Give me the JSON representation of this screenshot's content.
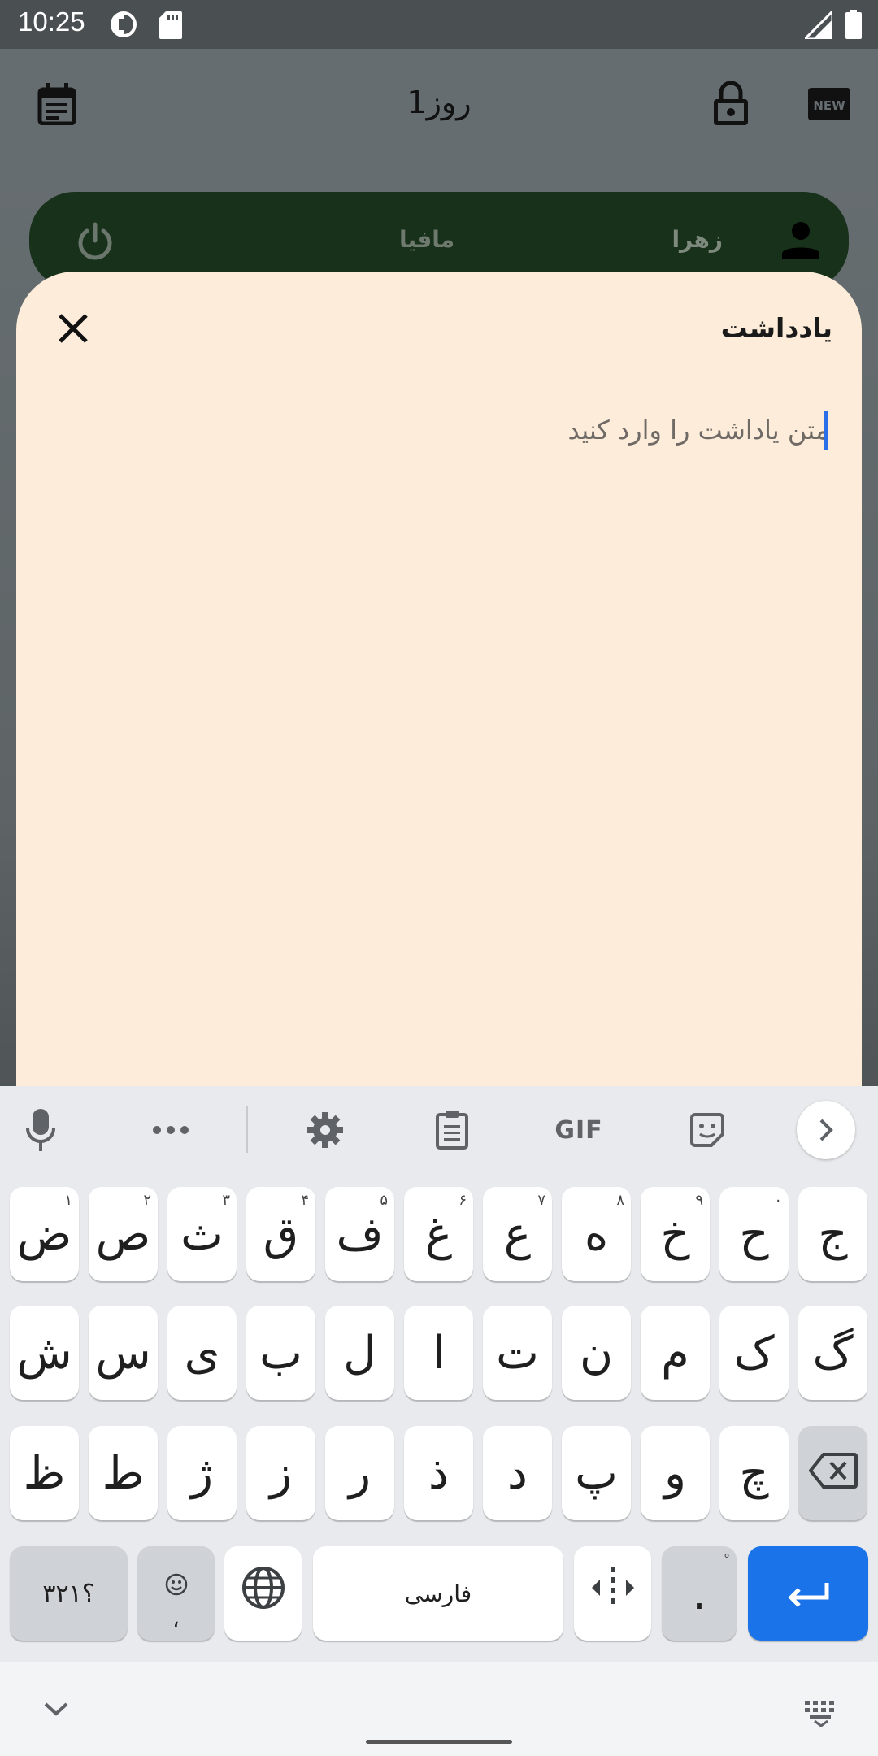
{
  "status_bar": {
    "time": "10:25"
  },
  "app_bar": {
    "title": "روز1"
  },
  "player_card": {
    "name": "زهرا",
    "role": "مافیا"
  },
  "note_sheet": {
    "title": "یادداشت",
    "input_value": "",
    "input_placeholder": "متن یاداشت را وارد کنید"
  },
  "keyboard": {
    "toolbar": {
      "gif_label": "GIF"
    },
    "row1": [
      {
        "char": "ض",
        "sup": "۱"
      },
      {
        "char": "ص",
        "sup": "۲"
      },
      {
        "char": "ث",
        "sup": "۳"
      },
      {
        "char": "ق",
        "sup": "۴"
      },
      {
        "char": "ف",
        "sup": "۵"
      },
      {
        "char": "غ",
        "sup": "۶"
      },
      {
        "char": "ع",
        "sup": "۷"
      },
      {
        "char": "ه",
        "sup": "۸"
      },
      {
        "char": "خ",
        "sup": "۹"
      },
      {
        "char": "ح",
        "sup": "۰"
      },
      {
        "char": "ج",
        "sup": ""
      }
    ],
    "row2": [
      "ش",
      "س",
      "ی",
      "ب",
      "ل",
      "ا",
      "ت",
      "ن",
      "م",
      "ک",
      "گ"
    ],
    "row3": [
      "ظ",
      "ط",
      "ژ",
      "ز",
      "ر",
      "ذ",
      "د",
      "پ",
      "و",
      "چ"
    ],
    "bottom": {
      "symbols_label": "؟۳۲۱",
      "comma_label": "،",
      "space_label": "فارسی",
      "period_label": "."
    }
  },
  "colors": {
    "sheet_bg": "#fcecd9",
    "player_card_bg": "#17311b",
    "enter_key": "#1a73e8"
  }
}
